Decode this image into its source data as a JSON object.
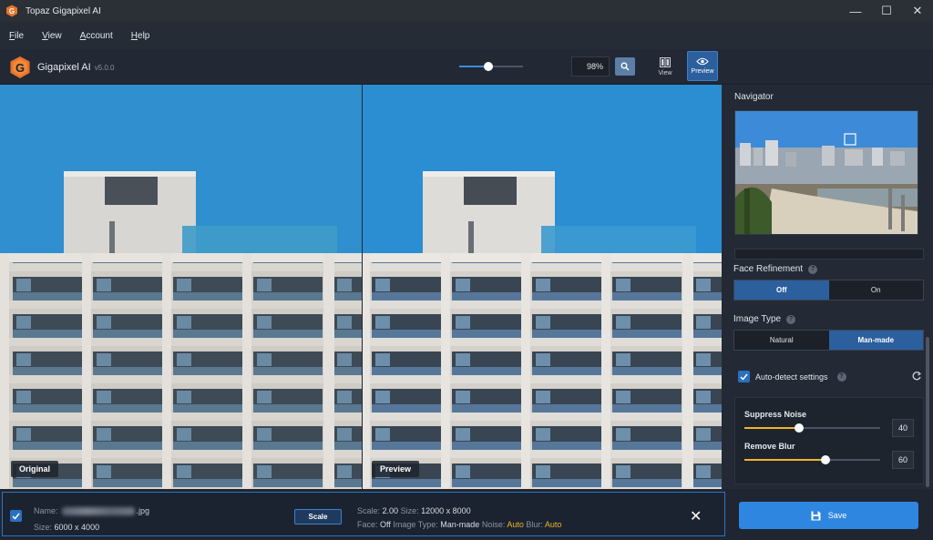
{
  "window": {
    "title": "Topaz Gigapixel AI",
    "controls": {
      "minimize": "—",
      "maximize": "☐",
      "close": "✕"
    }
  },
  "menu": {
    "items": [
      "File",
      "View",
      "Account",
      "Help"
    ]
  },
  "toolbar": {
    "app_name": "Gigapixel AI",
    "version": "v5.0.0",
    "zoom_value": "98%",
    "zoom_slider_fraction": 0.45,
    "view_label": "View",
    "preview_label": "Preview"
  },
  "viewer": {
    "original_label": "Original",
    "preview_label": "Preview"
  },
  "sidebar": {
    "navigator_title": "Navigator",
    "face_refinement": {
      "label": "Face Refinement",
      "options": [
        "Off",
        "On"
      ],
      "selected": "Off"
    },
    "image_type": {
      "label": "Image Type",
      "options": [
        "Natural",
        "Man-made"
      ],
      "selected": "Man-made"
    },
    "auto_detect": {
      "label": "Auto-detect settings",
      "checked": true
    },
    "suppress_noise": {
      "label": "Suppress Noise",
      "value": "40",
      "level": 40
    },
    "remove_blur": {
      "label": "Remove Blur",
      "value": "60",
      "level": 60
    }
  },
  "file": {
    "name_label": "Name:",
    "name_ext": ".jpg",
    "size_label": "Size:",
    "size_value": "6000 x 4000",
    "scale_button": "Scale",
    "scale_label": "Scale:",
    "scale_value": "2.00",
    "out_size_label": "Size:",
    "out_size_value": "12000 x 8000",
    "face_label": "Face:",
    "face_value": "Off",
    "image_type_label": "Image Type:",
    "image_type_value": "Man-made",
    "noise_label": "Noise:",
    "noise_value": "Auto",
    "blur_label": "Blur:",
    "blur_value": "Auto"
  },
  "save_button": "Save",
  "colors": {
    "accent": "#2f86e0",
    "selected": "#2c5f9e",
    "slider": "#f0b429",
    "auto_text": "#f0b429"
  }
}
